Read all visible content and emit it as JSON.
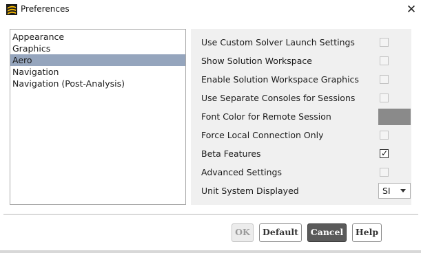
{
  "window": {
    "title": "Preferences",
    "close_glyph": "✕",
    "app_icon": "ansys-fluent-icon"
  },
  "categories": {
    "items": [
      {
        "label": "Appearance",
        "selected": false
      },
      {
        "label": "Graphics",
        "selected": false
      },
      {
        "label": "Aero",
        "selected": true
      },
      {
        "label": "Navigation",
        "selected": false
      },
      {
        "label": "Navigation (Post-Analysis)",
        "selected": false
      }
    ]
  },
  "settings": {
    "rows": [
      {
        "label": "Use Custom Solver Launch Settings",
        "control": "checkbox",
        "checked": false
      },
      {
        "label": "Show Solution Workspace",
        "control": "checkbox",
        "checked": false
      },
      {
        "label": "Enable Solution Workspace Graphics",
        "control": "checkbox",
        "checked": false
      },
      {
        "label": "Use Separate Consoles for Sessions",
        "control": "checkbox",
        "checked": false
      },
      {
        "label": "Font Color for Remote Session",
        "control": "color",
        "color": "#8a8a8a"
      },
      {
        "label": "Force Local Connection Only",
        "control": "checkbox",
        "checked": false
      },
      {
        "label": "Beta Features",
        "control": "checkbox",
        "checked": true
      },
      {
        "label": "Advanced Settings",
        "control": "checkbox",
        "checked": false
      },
      {
        "label": "Unit System Displayed",
        "control": "select",
        "value": "SI"
      }
    ],
    "check_glyph": "✓"
  },
  "buttons": {
    "ok_label": "OK",
    "default_label": "Default",
    "cancel_label": "Cancel",
    "help_label": "Help"
  },
  "colors": {
    "selection": "#95a5bd",
    "panel_bg": "#f0f0f0",
    "cancel_bg": "#5a5a5a"
  }
}
